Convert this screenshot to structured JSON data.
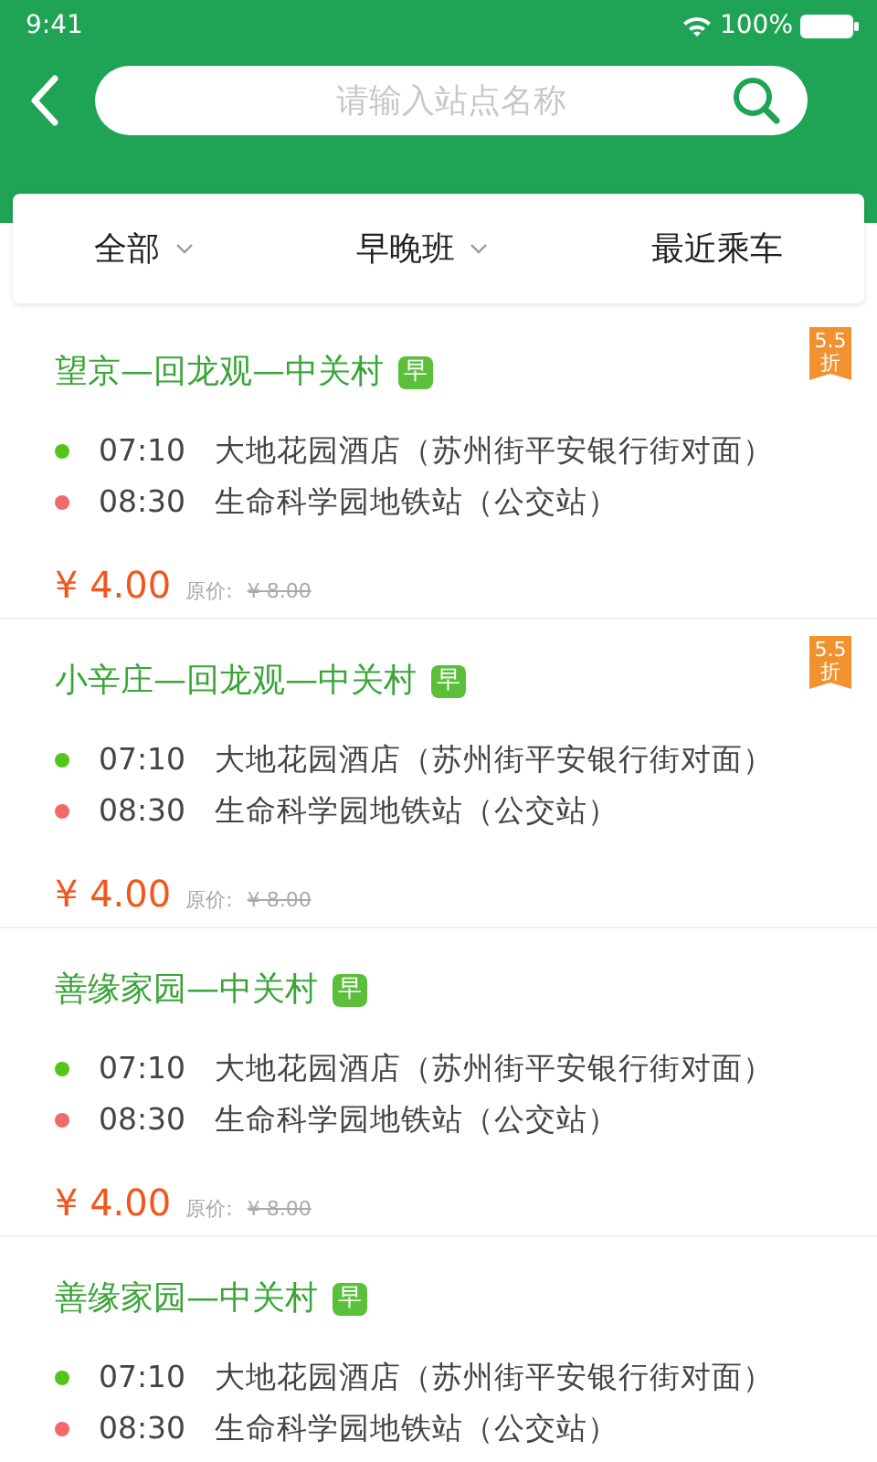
{
  "status_bar": {
    "time": "9:41",
    "battery": "100%"
  },
  "search": {
    "placeholder": "请输入站点名称"
  },
  "filters": [
    {
      "label": "全部",
      "dropdown": true
    },
    {
      "label": "早晚班",
      "dropdown": true
    },
    {
      "label": "最近乘车",
      "dropdown": false
    }
  ],
  "routes": [
    {
      "title": "望京—回龙观—中关村",
      "tag": "早",
      "discount": "5.5",
      "discount_unit": "折",
      "stops": [
        {
          "kind": "start",
          "time": "07:10",
          "name": "大地花园酒店（苏州街平安银行街对面）"
        },
        {
          "kind": "end",
          "time": "08:30",
          "name": "生命科学园地铁站（公交站）"
        }
      ],
      "price": "¥ 4.00",
      "original_label": "原价:",
      "original_price": "¥ 8.00"
    },
    {
      "title": "小辛庄—回龙观—中关村",
      "tag": "早",
      "discount": "5.5",
      "discount_unit": "折",
      "stops": [
        {
          "kind": "start",
          "time": "07:10",
          "name": "大地花园酒店（苏州街平安银行街对面）"
        },
        {
          "kind": "end",
          "time": "08:30",
          "name": "生命科学园地铁站（公交站）"
        }
      ],
      "price": "¥ 4.00",
      "original_label": "原价:",
      "original_price": "¥ 8.00"
    },
    {
      "title": "善缘家园—中关村",
      "tag": "早",
      "stops": [
        {
          "kind": "start",
          "time": "07:10",
          "name": "大地花园酒店（苏州街平安银行街对面）"
        },
        {
          "kind": "end",
          "time": "08:30",
          "name": "生命科学园地铁站（公交站）"
        }
      ],
      "price": "¥ 4.00",
      "original_label": "原价:",
      "original_price": "¥ 8.00"
    },
    {
      "title": "善缘家园—中关村",
      "tag": "早",
      "stops": [
        {
          "kind": "start",
          "time": "07:10",
          "name": "大地花园酒店（苏州街平安银行街对面）"
        },
        {
          "kind": "end",
          "time": "08:30",
          "name": "生命科学园地铁站（公交站）"
        }
      ]
    }
  ]
}
